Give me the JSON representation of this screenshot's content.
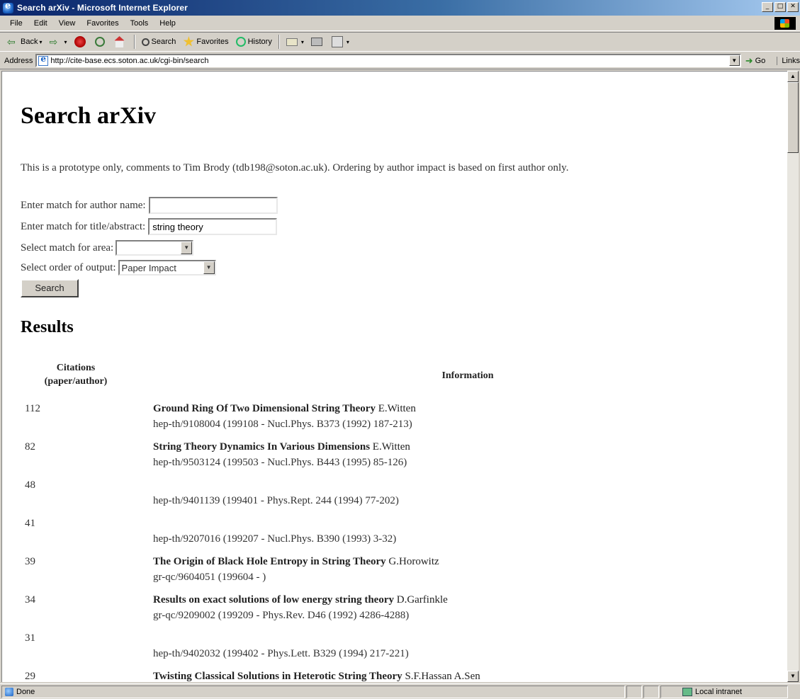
{
  "window": {
    "title": "Search arXiv - Microsoft Internet Explorer",
    "min": "_",
    "max": "□",
    "close": "✕"
  },
  "menu": [
    "File",
    "Edit",
    "View",
    "Favorites",
    "Tools",
    "Help"
  ],
  "toolbar": {
    "back": "Back",
    "search": "Search",
    "favorites": "Favorites",
    "history": "History"
  },
  "address": {
    "label": "Address",
    "url": "http://cite-base.ecs.soton.ac.uk/cgi-bin/search",
    "go": "Go",
    "links": "Links"
  },
  "page": {
    "title": "Search arXiv",
    "intro": "This is a prototype only, comments to Tim Brody (tdb198@soton.ac.uk). Ordering by author impact is based on first author only.",
    "form": {
      "author_label": "Enter match for author name:",
      "author_value": "",
      "title_label": "Enter match for title/abstract:",
      "title_value": "string theory",
      "area_label": "Select match for area:",
      "area_value": "",
      "order_label": "Select order of output:",
      "order_value": "Paper Impact",
      "search_button": "Search"
    },
    "results_heading": "Results",
    "columns": {
      "citations_line1": "Citations",
      "citations_line2": "(paper/author)",
      "information": "Information"
    },
    "results": [
      {
        "citations": "112",
        "title": "Ground Ring Of Two Dimensional String Theory",
        "author": "E.Witten",
        "id": "hep-th/9108004 (199108 - Nucl.Phys. B373 (1992) 187-213)"
      },
      {
        "citations": "82",
        "title": "String Theory Dynamics In Various Dimensions",
        "author": "E.Witten",
        "id": "hep-th/9503124 (199503 - Nucl.Phys. B443 (1995) 85-126)"
      },
      {
        "citations": "48",
        "title": "",
        "author": "",
        "id": "hep-th/9401139 (199401 - Phys.Rept. 244 (1994) 77-202)"
      },
      {
        "citations": "41",
        "title": "",
        "author": "",
        "id": "hep-th/9207016 (199207 - Nucl.Phys. B390 (1993) 3-32)"
      },
      {
        "citations": "39",
        "title": "The Origin of Black Hole Entropy in String Theory",
        "author": "G.Horowitz",
        "id": "gr-qc/9604051 (199604 - )"
      },
      {
        "citations": "34",
        "title": "Results on exact solutions of low energy string theory",
        "author": "D.Garfinkle",
        "id": "gr-qc/9209002 (199209 - Phys.Rev. D46 (1992) 4286-4288)"
      },
      {
        "citations": "31",
        "title": "",
        "author": "",
        "id": "hep-th/9402032 (199402 - Phys.Lett. B329 (1994) 217-221)"
      },
      {
        "citations": "29",
        "title": "Twisting Classical Solutions in Heterotic String Theory",
        "author": "S.F.Hassan A.Sen",
        "id": ""
      }
    ]
  },
  "status": {
    "text": "Done",
    "zone": "Local intranet"
  }
}
